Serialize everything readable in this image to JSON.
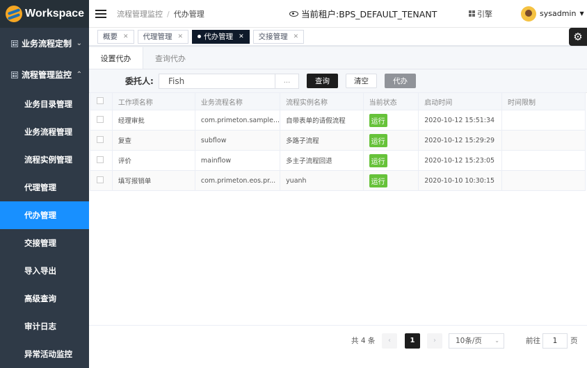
{
  "app": {
    "title": "Workspace"
  },
  "sidebar": {
    "groups": [
      {
        "label": "业务流程定制",
        "expanded": false
      },
      {
        "label": "流程管理监控",
        "expanded": true
      }
    ],
    "items": [
      {
        "label": "业务目录管理"
      },
      {
        "label": "业务流程管理"
      },
      {
        "label": "流程实例管理"
      },
      {
        "label": "代理管理"
      },
      {
        "label": "代办管理",
        "active": true
      },
      {
        "label": "交接管理"
      },
      {
        "label": "导入导出"
      },
      {
        "label": "高级查询"
      },
      {
        "label": "审计日志"
      },
      {
        "label": "异常活动监控"
      }
    ]
  },
  "header": {
    "breadcrumb": [
      "流程管理监控",
      "代办管理"
    ],
    "breadcrumb_sep": "/",
    "tenant": "当前租户:BPS_DEFAULT_TENANT",
    "guide": "引擎",
    "user": "sysadmin"
  },
  "tabs": [
    {
      "label": "概要",
      "active": false
    },
    {
      "label": "代理管理",
      "active": false
    },
    {
      "label": "代办管理",
      "active": true
    },
    {
      "label": "交接管理",
      "active": false
    }
  ],
  "subtabs": [
    {
      "label": "设置代办",
      "active": true
    },
    {
      "label": "查询代办",
      "active": false
    }
  ],
  "form": {
    "principal_label": "委托人:",
    "principal_value": "Fish",
    "picker": "...",
    "query_btn": "查询",
    "clear_btn": "清空",
    "agent_btn": "代办"
  },
  "table": {
    "columns": [
      "工作项名称",
      "业务流程名称",
      "流程实例名称",
      "当前状态",
      "启动时间",
      "时间限制"
    ],
    "rows": [
      {
        "name": "经理审批",
        "process": "com.primeton.sample...",
        "instance": "自带表单的请假流程",
        "status": "运行",
        "start": "2020-10-12 15:51:34",
        "limit": ""
      },
      {
        "name": "复查",
        "process": "subflow",
        "instance": "多路子流程",
        "status": "运行",
        "start": "2020-10-12 15:29:29",
        "limit": ""
      },
      {
        "name": "评价",
        "process": "mainflow",
        "instance": "多主子流程回退",
        "status": "运行",
        "start": "2020-10-12 15:23:05",
        "limit": ""
      },
      {
        "name": "填写报销单",
        "process": "com.primeton.eos.pr...",
        "instance": "yuanh",
        "status": "运行",
        "start": "2020-10-10 10:30:15",
        "limit": ""
      }
    ]
  },
  "pagination": {
    "total": "共 4 条",
    "current": "1",
    "prev": "‹",
    "next": "›",
    "page_size": "10条/页",
    "goto_label": "前往",
    "goto_value": "1",
    "goto_suffix": "页"
  },
  "colors": {
    "accent": "#1890ff",
    "sidebar": "#2f3a47",
    "status_green": "#67c23a"
  }
}
